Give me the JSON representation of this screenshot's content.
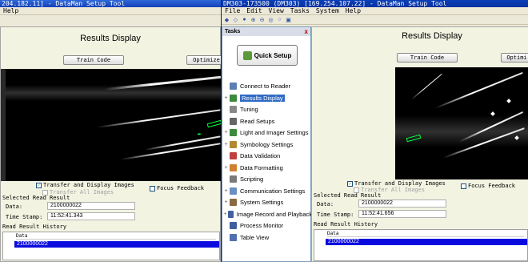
{
  "left_window": {
    "title": "204.182.11] - DataMan Setup Tool",
    "menu": [
      "Help"
    ],
    "results_title": "Results Display",
    "train_button": "Train Code",
    "optimize_button": "Optimize",
    "transfer_label": "Transfer and Display Images",
    "transfer_all_label": "Transfer All Images",
    "focus_label": "Focus Feedback",
    "selected_heading": "Selected Read Result",
    "data_label": "Data:",
    "data_value": "2100000022",
    "time_label": "Time Stamp:",
    "time_value": "11:52:41.343",
    "history_heading": "Read Result History",
    "history_column": "Data",
    "history_rows": [
      "2100000022"
    ]
  },
  "right_window": {
    "title": "DM303-173500 (DM303) [169.254.107.22] - DataMan Setup Tool",
    "menu": [
      "File",
      "Edit",
      "View",
      "Tasks",
      "System",
      "Help"
    ],
    "results_title": "Results Display",
    "train_button": "Train Code",
    "optimize_button": "Optimi",
    "transfer_label": "Transfer and Display Images",
    "transfer_all_label": "Transfer All Images",
    "focus_label": "Focus Feedback",
    "selected_heading": "Selected Read Result",
    "data_label": "Data:",
    "data_value": "2100000022",
    "time_label": "Time Stamp:",
    "time_value": "11:52:41.656",
    "history_heading": "Read Result History",
    "history_column": "Data",
    "history_rows": [
      "2100000022"
    ]
  },
  "tasks": {
    "heading": "Tasks",
    "close": "x",
    "quick_setup": "Quick Setup",
    "items": [
      {
        "label": "Connect to Reader",
        "expander": "",
        "color": "#5f7fb0"
      },
      {
        "label": "Results Display",
        "expander": "+",
        "color": "#3c8a3c"
      },
      {
        "label": "Tuning",
        "expander": "",
        "color": "#888888"
      },
      {
        "label": "Read Setups",
        "expander": "",
        "color": "#666666"
      },
      {
        "label": "Light and Imager Settings",
        "expander": "+",
        "color": "#3c8a3c"
      },
      {
        "label": "Symbology Settings",
        "expander": "+",
        "color": "#b08a30"
      },
      {
        "label": "Data Validation",
        "expander": "",
        "color": "#c04040"
      },
      {
        "label": "Data Formatting",
        "expander": "+",
        "color": "#d08030"
      },
      {
        "label": "Scripting",
        "expander": "",
        "color": "#7a7a7a"
      },
      {
        "label": "Communication Settings",
        "expander": "+",
        "color": "#6a8fc0"
      },
      {
        "label": "System Settings",
        "expander": "+",
        "color": "#8a6a40"
      },
      {
        "label": "Image Record and Playback",
        "expander": "+",
        "color": "#4060a0"
      },
      {
        "label": "Process Monitor",
        "expander": "",
        "color": "#4060a0"
      },
      {
        "label": "Table View",
        "expander": "",
        "color": "#5070b0"
      }
    ]
  }
}
